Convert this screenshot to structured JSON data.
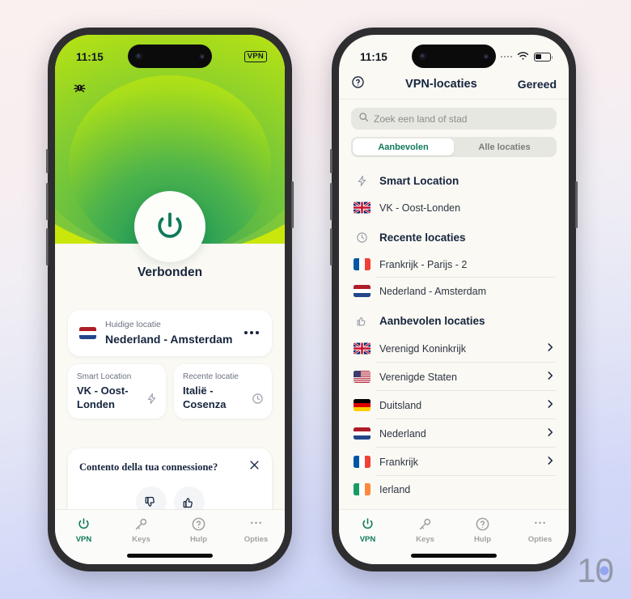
{
  "watermark": {
    "text": "10"
  },
  "left_phone": {
    "status": {
      "time": "11:15",
      "vpn_badge": "VPN"
    },
    "connection_state": "Verbonden",
    "current_location": {
      "caption": "Huidige locatie",
      "value": "Nederland - Amsterdam",
      "flag": "nl"
    },
    "smart_location": {
      "caption": "Smart Location",
      "value": "VK - Oost-Londen",
      "icon": "lightning-icon"
    },
    "recent_location": {
      "caption": "Recente locatie",
      "value": "Italië - Cosenza",
      "icon": "clock-icon"
    },
    "feedback": {
      "title": "Contento della tua connessione?",
      "close": "close-icon",
      "down": "thumbs-down-icon",
      "up": "thumbs-up-icon"
    },
    "tabs": [
      {
        "label": "VPN",
        "icon": "power-icon",
        "active": true
      },
      {
        "label": "Keys",
        "icon": "key-icon",
        "active": false
      },
      {
        "label": "Hulp",
        "icon": "help-circle-icon",
        "active": false
      },
      {
        "label": "Opties",
        "icon": "more-dots-icon",
        "active": false
      }
    ]
  },
  "right_phone": {
    "status": {
      "time": "11:15"
    },
    "nav": {
      "help": "help-circle-icon",
      "title": "VPN-locaties",
      "done": "Gereed"
    },
    "search": {
      "placeholder": "Zoek een land of stad",
      "value": "",
      "icon": "search-icon"
    },
    "segments": [
      {
        "label": "Aanbevolen",
        "active": true
      },
      {
        "label": "Alle locaties",
        "active": false
      }
    ],
    "sections": [
      {
        "title": "Smart Location",
        "icon": "lightning-icon",
        "rows": [
          {
            "label": "VK - Oost-Londen",
            "flag": "gb",
            "chevron": false,
            "sep": false
          }
        ]
      },
      {
        "title": "Recente locaties",
        "icon": "clock-icon",
        "rows": [
          {
            "label": "Frankrijk - Parijs - 2",
            "flag": "fr",
            "chevron": false,
            "sep": true
          },
          {
            "label": "Nederland - Amsterdam",
            "flag": "nl",
            "chevron": false,
            "sep": false
          }
        ]
      },
      {
        "title": "Aanbevolen locaties",
        "icon": "thumbs-up-icon",
        "rows": [
          {
            "label": "Verenigd Koninkrijk",
            "flag": "gb",
            "chevron": true,
            "sep": true
          },
          {
            "label": "Verenigde Staten",
            "flag": "us",
            "chevron": true,
            "sep": true
          },
          {
            "label": "Duitsland",
            "flag": "de",
            "chevron": true,
            "sep": true
          },
          {
            "label": "Nederland",
            "flag": "nl",
            "chevron": true,
            "sep": true
          },
          {
            "label": "Frankrijk",
            "flag": "fr",
            "chevron": true,
            "sep": true
          },
          {
            "label": "Ierland",
            "flag": "ie",
            "chevron": false,
            "sep": false
          }
        ]
      }
    ],
    "tabs": [
      {
        "label": "VPN",
        "icon": "power-icon",
        "active": true
      },
      {
        "label": "Keys",
        "icon": "key-icon",
        "active": false
      },
      {
        "label": "Hulp",
        "icon": "help-circle-icon",
        "active": false
      },
      {
        "label": "Opties",
        "icon": "more-dots-icon",
        "active": false
      }
    ]
  },
  "colors": {
    "accent_green": "#0f7a5a",
    "lime": "#c9e70a",
    "navy": "#16243d",
    "bg_top": "#faf0ef",
    "bg_bottom": "#cbd3f6"
  }
}
